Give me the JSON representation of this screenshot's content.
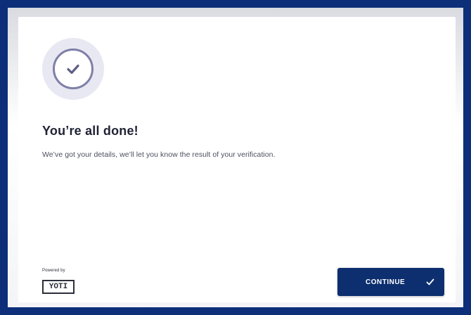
{
  "colors": {
    "frame": "#0d2f7a",
    "accent_button": "#0d2f6f",
    "check_ring": "#7e7fa6",
    "check_halo": "#e7e8f2",
    "title_text": "#1f2233",
    "body_text": "#4b4f5e"
  },
  "status": {
    "icon": "check-circle-icon",
    "title": "You’re all done!",
    "message": "We’ve got your details, we’ll let you know the result of your verification."
  },
  "footer": {
    "powered_by": "Powered by",
    "brand": "YOTI",
    "continue_label": "CONTINUE",
    "continue_icon": "check-icon"
  }
}
